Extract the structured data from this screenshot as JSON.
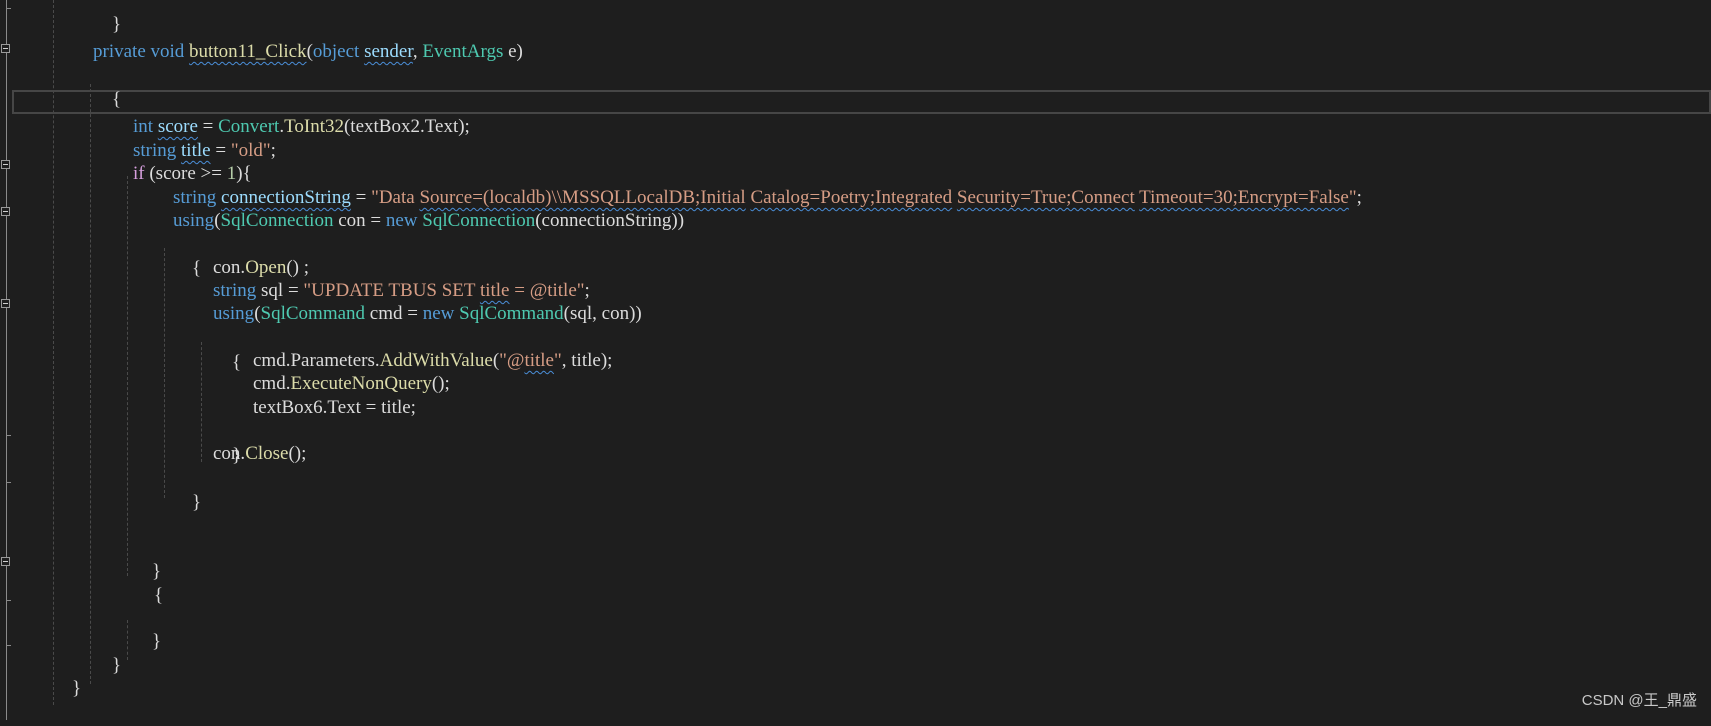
{
  "editor": {
    "theme_colors": {
      "background": "#1e1e1e",
      "keyword": "#569cd6",
      "control_keyword": "#d8a0df",
      "type": "#4ec9b0",
      "method": "#dcdcaa",
      "string": "#d69d85",
      "number": "#b5cea8",
      "identifier": "#9cdcfe",
      "text": "#dcdcdc"
    },
    "lines": {
      "l0_brace": "}",
      "l1": {
        "private": "private",
        "void": "void",
        "name": "button11_Click",
        "p1": "(",
        "object": "object",
        "sender": "sender",
        "comma": ", ",
        "eventargs": "EventArgs",
        "e": " e)"
      },
      "l2_brace": "{",
      "l4": {
        "int": "int",
        "score": "score",
        "eq": " = ",
        "convert": "Convert",
        "dot": ".",
        "toint": "ToInt32",
        "rest": "(textBox2.Text);"
      },
      "l5": {
        "string": "string",
        "title": "title",
        "eq": " = ",
        "val": "\"old\"",
        "semi": ";"
      },
      "l6": {
        "if": "if",
        "cond": " (score >= ",
        "one": "1",
        "end": "){"
      },
      "l7": {
        "string": "string",
        "connectionString": "connectionString",
        "eq": " = ",
        "s1": "\"Data ",
        "s2": "Source=(localdb)\\\\MSSQLLocalDB;Initial",
        "s3": " ",
        "s4": "Catalog=Poetry;Integrated",
        "s5": " ",
        "s6": "Security=True;Connect",
        "s7": " ",
        "s8": "Timeout=30;Encrypt=False",
        "s9": "\"",
        "semi": ";"
      },
      "l8": {
        "using": "using",
        "p": "(",
        "sqlconn": "SqlConnection",
        "con": " con = ",
        "new": "new",
        "sp": " ",
        "sqlconn2": "SqlConnection",
        "rest": "(connectionString))"
      },
      "l9_brace": "{",
      "l10": {
        "con": "con.",
        "open": "Open",
        "rest": "() ;"
      },
      "l11": {
        "string": "string",
        "sql": " sql = ",
        "s1": "\"UPDATE TBUS SET ",
        "s2": "title",
        "s3": " = @title\"",
        "semi": ";"
      },
      "l12": {
        "using": "using",
        "p": "(",
        "sqlcmd": "SqlCommand",
        "cmd": " cmd = ",
        "new": "new",
        "sp": " ",
        "sqlcmd2": "SqlCommand",
        "rest": "(sql, con))"
      },
      "l13_brace": "{",
      "l14": {
        "cmd": "cmd.Parameters.",
        "add": "AddWithValue",
        "p": "(",
        "s1": "\"@",
        "s2": "title",
        "s3": "\"",
        "rest": ", title);"
      },
      "l15": {
        "cmd": "cmd.",
        "exec": "ExecuteNonQuery",
        "rest": "();"
      },
      "l16": {
        "tb": "textBox6.Text = title;"
      },
      "l17_brace": "}",
      "l18": {
        "con": "con.",
        "close": "Close",
        "rest": "();"
      },
      "l19_brace": "}",
      "l22_brace": "}",
      "l23_brace": "{",
      "l25_brace": "}",
      "l26_brace": "}",
      "l27_brace": "}"
    }
  },
  "watermark": "CSDN @王_鼎盛"
}
